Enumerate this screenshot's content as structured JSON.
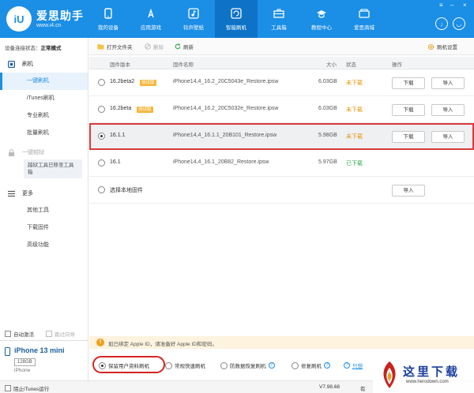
{
  "brand": {
    "name": "爱思助手",
    "url": "www.i4.cn",
    "logo_text": "iU"
  },
  "nav": [
    {
      "label": "我的设备",
      "icon": "phone-icon"
    },
    {
      "label": "应用游戏",
      "icon": "appstore-icon"
    },
    {
      "label": "铃声壁纸",
      "icon": "music-icon"
    },
    {
      "label": "智能刷机",
      "icon": "flash-icon"
    },
    {
      "label": "工具箱",
      "icon": "toolbox-icon"
    },
    {
      "label": "教程中心",
      "icon": "graduation-cap-icon"
    },
    {
      "label": "爱思商城",
      "icon": "store-icon"
    }
  ],
  "active_nav": "智能刷机",
  "sidebar": {
    "connection_label": "设备连接状态：",
    "connection_value": "正常模式",
    "sections": [
      {
        "label": "刷机",
        "items": [
          "一键刷机",
          "iTunes刷机",
          "专业刷机",
          "批量刷机"
        ]
      },
      {
        "label": "一键越狱",
        "note": "越狱工具已移至工具箱"
      },
      {
        "label": "更多",
        "items": [
          "其他工具",
          "下载固件",
          "高级功能"
        ]
      }
    ],
    "active_item": "一键刷机",
    "auto_activate": "自动激活",
    "skip_guide": "跳过向导",
    "device": {
      "name": "iPhone 13 mini",
      "capacity": "128GB",
      "type": "iPhone"
    }
  },
  "toolbar": {
    "open_folder": "打开文件夹",
    "delete": "删除",
    "refresh": "刷新",
    "settings": "刷机设置"
  },
  "table": {
    "headers": {
      "version": "固件版本",
      "name": "固件名称",
      "size": "大小",
      "status": "状态",
      "action": "操作"
    },
    "rows": [
      {
        "version": "16.2beta2",
        "tag": "测试版",
        "name": "iPhone14,4_16.2_20C5043e_Restore.ipsw",
        "size": "6.03GB",
        "status": "未下载",
        "status_color": "#e89300",
        "download": "下载",
        "import": "导入",
        "selected": false
      },
      {
        "version": "16.2beta",
        "tag": "测试版",
        "name": "iPhone14,4_16.2_20C5032e_Restore.ipsw",
        "size": "6.03GB",
        "status": "未下载",
        "status_color": "#e89300",
        "download": "下载",
        "import": "导入",
        "selected": false
      },
      {
        "version": "16.1.1",
        "tag": "",
        "name": "iPhone14,4_16.1.1_20B101_Restore.ipsw",
        "size": "5.98GB",
        "status": "未下载",
        "status_color": "#e89300",
        "download": "下载",
        "import": "导入",
        "selected": true
      },
      {
        "version": "16.1",
        "tag": "",
        "name": "iPhone14,4_16.1_20B82_Restore.ipsw",
        "size": "5.97GB",
        "status": "已下载",
        "status_color": "#2aa84a",
        "download": "",
        "import": "",
        "selected": false
      }
    ],
    "local_firmware": {
      "label": "选择本地固件",
      "import": "导入"
    }
  },
  "notice": "如已绑定 Apple ID，请准备好 Apple ID和密码。",
  "flash_options": [
    {
      "label": "保留用户资料刷机",
      "selected": true
    },
    {
      "label": "常规快速刷机",
      "selected": false
    },
    {
      "label": "防数据恢复刷机",
      "selected": false
    },
    {
      "label": "修复刷机",
      "selected": false
    }
  ],
  "faq_link": "只想",
  "statusbar": {
    "block_itunes": "阻止iTunes运行",
    "version": "V7.98.68",
    "extra": "有"
  },
  "watermark": {
    "title": "这里下载",
    "url": "www.herodown.com"
  }
}
